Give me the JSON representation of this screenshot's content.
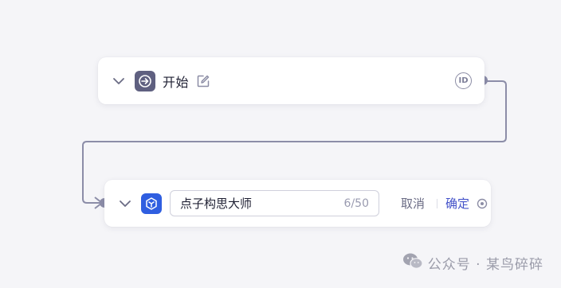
{
  "start_node": {
    "title": "开始",
    "icon": "start-arrow-icon",
    "id_badge": "ID"
  },
  "llm_node": {
    "icon": "cube-icon",
    "name_value": "点子构思大师",
    "char_count": "6/50",
    "cancel_label": "取消",
    "confirm_label": "确定"
  },
  "watermark": {
    "text": "公众号 · 某鸟碎碎"
  },
  "colors": {
    "connector": "#8c8da8",
    "accent": "#4352c9",
    "node_icon_start": "#5f6080",
    "node_icon_llm": "#2f5ee0"
  }
}
